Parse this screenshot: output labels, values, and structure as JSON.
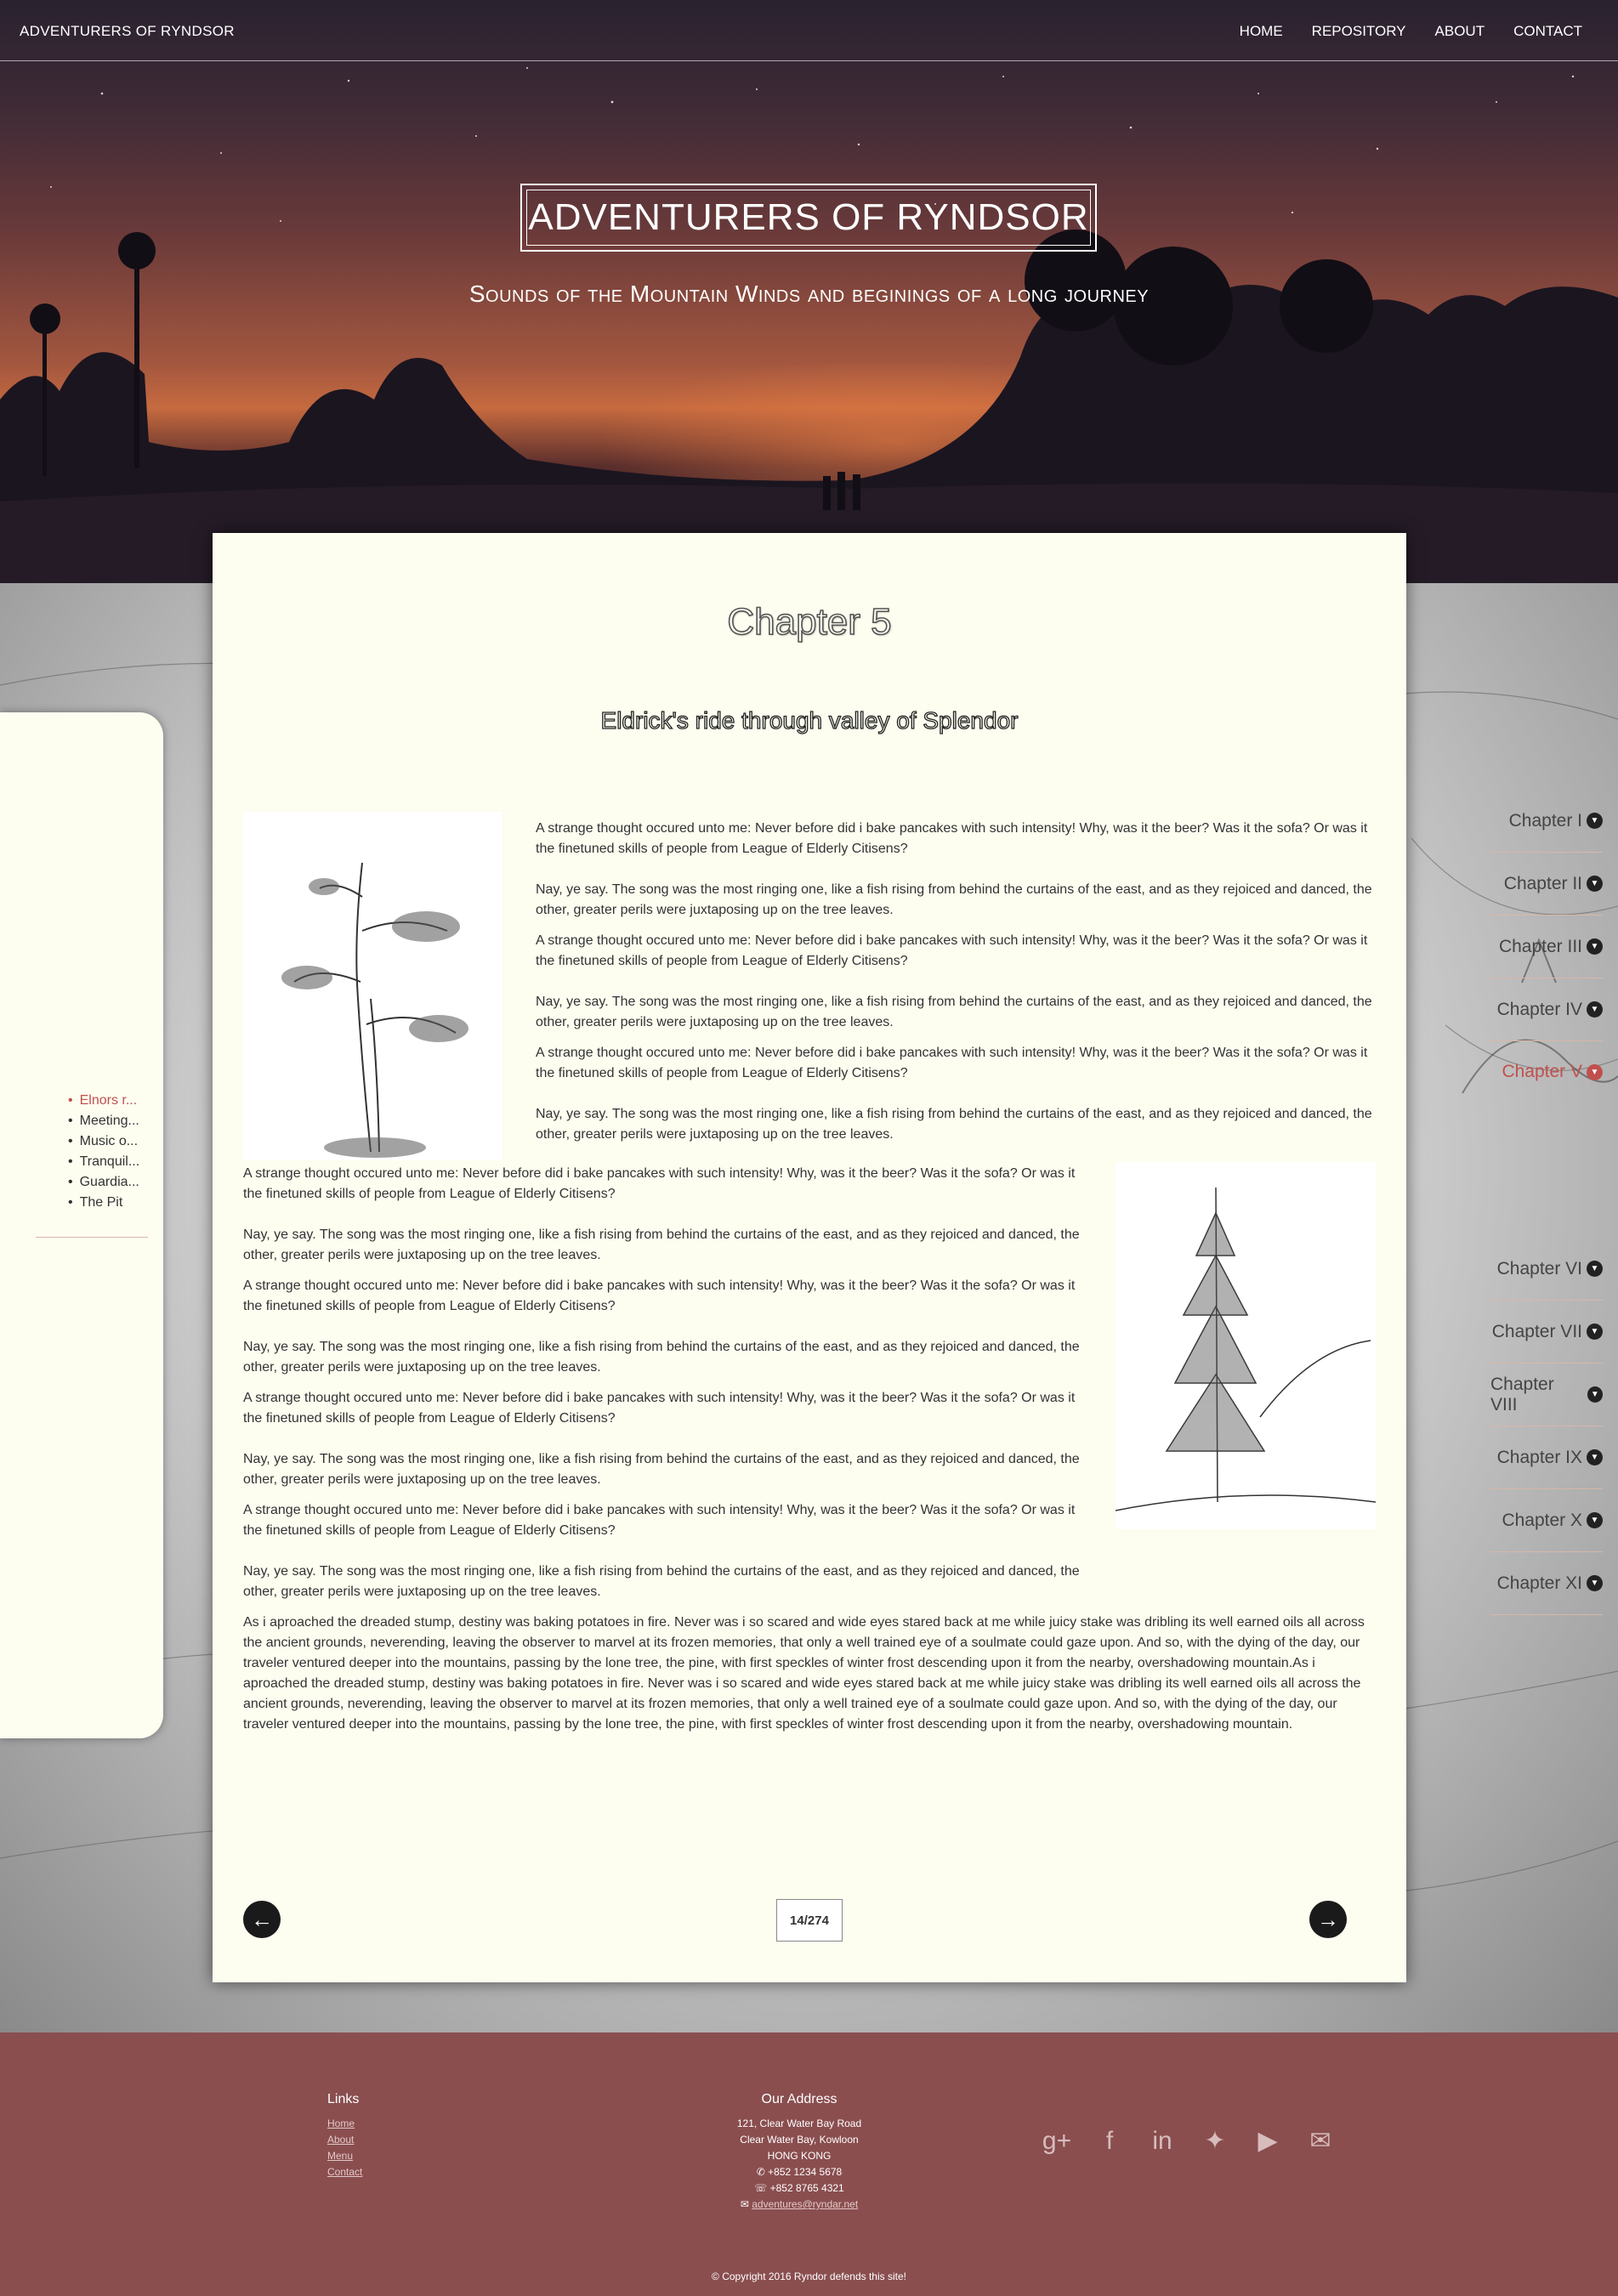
{
  "nav": {
    "brand": "ADVENTURERS OF RYNDSOR",
    "links": [
      "HOME",
      "REPOSITORY",
      "ABOUT",
      "CONTACT"
    ]
  },
  "hero": {
    "title": "ADVENTURERS OF RYNDSOR",
    "subtitle": "Sounds of the Mountain Winds and beginings of a long journey"
  },
  "sidebar": {
    "chapters": [
      "Chapter I",
      "Chapter II",
      "Chapter III",
      "Chapter IV",
      "Chapter V",
      "Chapter VI",
      "Chapter VII",
      "Chapter VIII",
      "Chapter IX",
      "Chapter X",
      "Chapter XI"
    ],
    "active_chapter": "Chapter V",
    "subchapters": [
      "Elnors r...",
      "Meeting...",
      "Music o...",
      "Tranquil...",
      "Guardia...",
      "The Pit"
    ],
    "current_subchapter": "Elnors r...",
    "chevron_icon": "chevron-circle-down-icon"
  },
  "content": {
    "chapter_title": "Chapter 5",
    "chapter_subtitle": "Eldrick's ride through valley of Splendor",
    "p_thought": "A strange thought occured unto me: Never before did i bake pancakes with such intensity! Why, was it the beer? Was it the sofa? Or was it the finetuned skills of people from League of Elderly Citisens?",
    "p_song": "Nay, ye say. The song was the most ringing one, like a fish rising from behind the curtains of the east, and as they rejoiced and danced, the other, greater perils were juxtaposing up on the tree leaves.",
    "p_final": "As i aproached the dreaded stump, destiny was baking potatoes in fire. Never was i so scared and wide eyes stared back at me while juicy stake was dribling its well earned oils all across the ancient grounds, neverending, leaving the observer to marvel at its frozen memories, that only a well trained eye of a soulmate could gaze upon. And so, with the dying of the day, our traveler ventured deeper into the mountains, passing by the lone tree, the pine, with first speckles of winter frost descending upon it from the nearby, overshadowing mountain.As i aproached the dreaded stump, destiny was baking potatoes in fire. Never was i so scared and wide eyes stared back at me while juicy stake was dribling its well earned oils all across the ancient grounds, neverending, leaving the observer to marvel at its frozen memories, that only a well trained eye of a soulmate could gaze upon. And so, with the dying of the day, our traveler ventured deeper into the mountains, passing by the lone tree, the pine, with first speckles of winter frost descending upon it from the nearby, overshadowing mountain.",
    "page_counter": "14/274",
    "prev_icon": "arrow-left-circle-icon",
    "next_icon": "arrow-right-circle-icon"
  },
  "footer": {
    "links_title": "Links",
    "links": [
      "Home",
      "About",
      "Menu",
      "Contact"
    ],
    "address_title": "Our Address",
    "address_lines": [
      "121, Clear Water Bay Road",
      "Clear Water Bay, Kowloon",
      "HONG KONG"
    ],
    "phone": "+852 1234 5678",
    "fax": "+852 8765 4321",
    "email": "adventures@ryndar.net",
    "social_icons": [
      "google-plus-icon",
      "facebook-icon",
      "linkedin-icon",
      "twitter-icon",
      "youtube-icon",
      "envelope-icon"
    ],
    "copyright": "© Copyright 2016 Ryndor defends this site!"
  },
  "colors": {
    "accent_active": "#c0504d",
    "card_bg": "#fdfdf0",
    "footer_bg": "#8a4e4f"
  }
}
